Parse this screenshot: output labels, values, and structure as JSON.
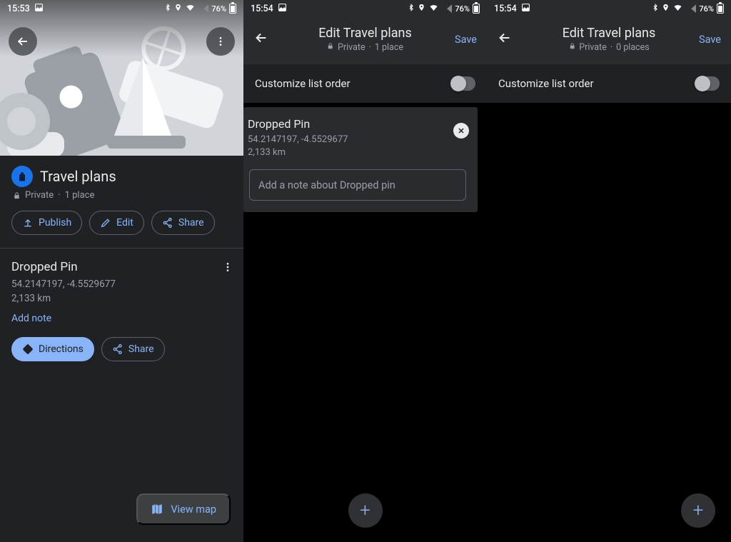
{
  "status_icons": {
    "bt": "bluetooth-icon",
    "loc": "location-icon",
    "wifi": "wifi-icon",
    "sig": "signal-icon",
    "batt": "battery-icon"
  },
  "p1": {
    "clock": "15:53",
    "battery": "76%",
    "title": "Travel plans",
    "privacy": "Private",
    "count": "1 place",
    "chips": {
      "publish": "Publish",
      "edit": "Edit",
      "share": "Share"
    },
    "place": {
      "title": "Dropped Pin",
      "coords": "54.2147197, -4.5529677",
      "distance": "2,133 km",
      "add_note": "Add note",
      "directions": "Directions",
      "share": "Share"
    },
    "view_map": "View map"
  },
  "p2": {
    "clock": "15:54",
    "battery": "76%",
    "header_title": "Edit Travel plans",
    "privacy": "Private",
    "count": "1 place",
    "save": "Save",
    "customize": "Customize list order",
    "card": {
      "title": "Dropped Pin",
      "coords": "54.2147197, -4.5529677",
      "distance": "2,133 km",
      "note_placeholder": "Add a note about Dropped pin"
    }
  },
  "p3": {
    "clock": "15:54",
    "battery": "76%",
    "header_title": "Edit Travel plans",
    "privacy": "Private",
    "count": "0 places",
    "save": "Save",
    "customize": "Customize list order"
  }
}
